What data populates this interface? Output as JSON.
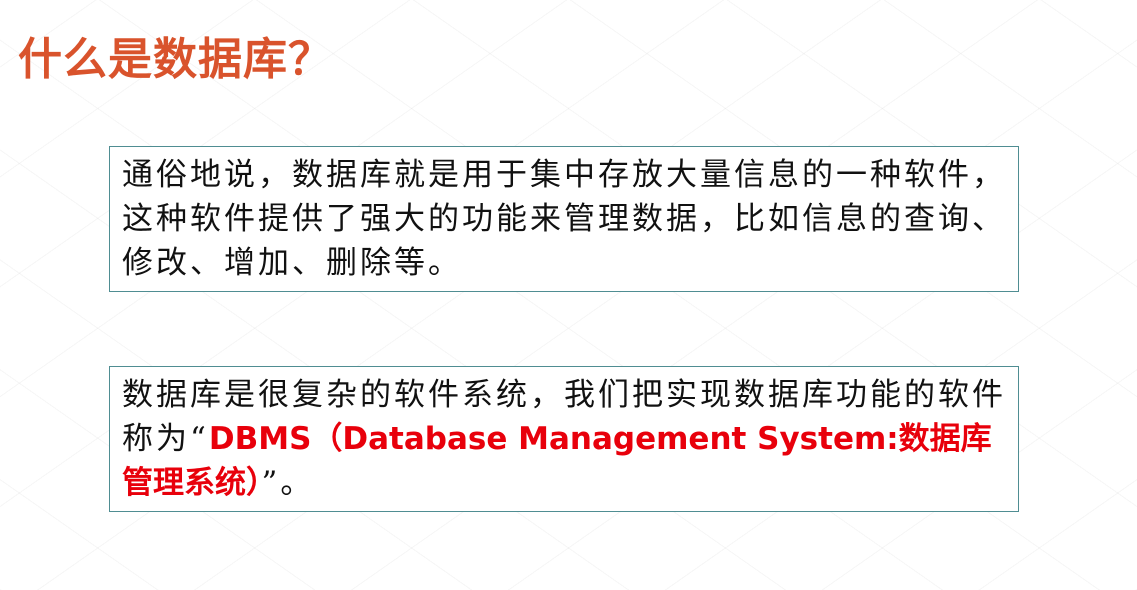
{
  "slide": {
    "title": "什么是数据库？",
    "title_color": "#d9532c",
    "highlight_color": "#e8000b",
    "box1": {
      "text": "通俗地说，数据库就是用于集中存放大量信息的一种软件，这种软件提供了强大的功能来管理数据，比如信息的查询、修改、增加、删除等。"
    },
    "box2": {
      "text_before": "数据库是很复杂的软件系统，我们把实现数据库功能的软件称为“",
      "highlight": "DBMS（Database Management System:数据库管理系统）",
      "text_after": "”。"
    }
  }
}
